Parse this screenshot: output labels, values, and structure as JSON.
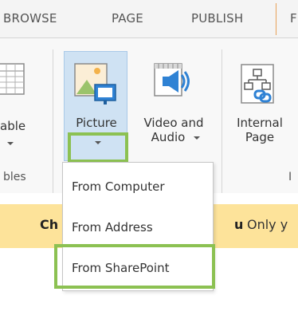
{
  "tabs": [
    "BROWSE",
    "PAGE",
    "PUBLISH",
    "F"
  ],
  "ribbon": {
    "table_button": {
      "label": "able",
      "icon": "table-icon"
    },
    "picture_button": {
      "label": "Picture",
      "icon": "picture-icon"
    },
    "video_button": {
      "label_line1": "Video and",
      "label_line2": "Audio",
      "icon": "video-audio-icon"
    },
    "link_button": {
      "label_line1": "Internal",
      "label_line2": "Page",
      "icon": "internal-page-link-icon"
    },
    "group_footers": {
      "tables": "bles",
      "links": "I"
    }
  },
  "picture_menu": {
    "items": [
      "From Computer",
      "From Address",
      "From SharePoint"
    ]
  },
  "notice": {
    "bold_text": "Ch",
    "bold_tail": "u",
    "text": "Only y"
  },
  "colors": {
    "highlight_green": "#8cc152",
    "notice_background": "#fde39a",
    "selected_button": "#cfe2f3",
    "publish_separator": "#e8a35a"
  }
}
